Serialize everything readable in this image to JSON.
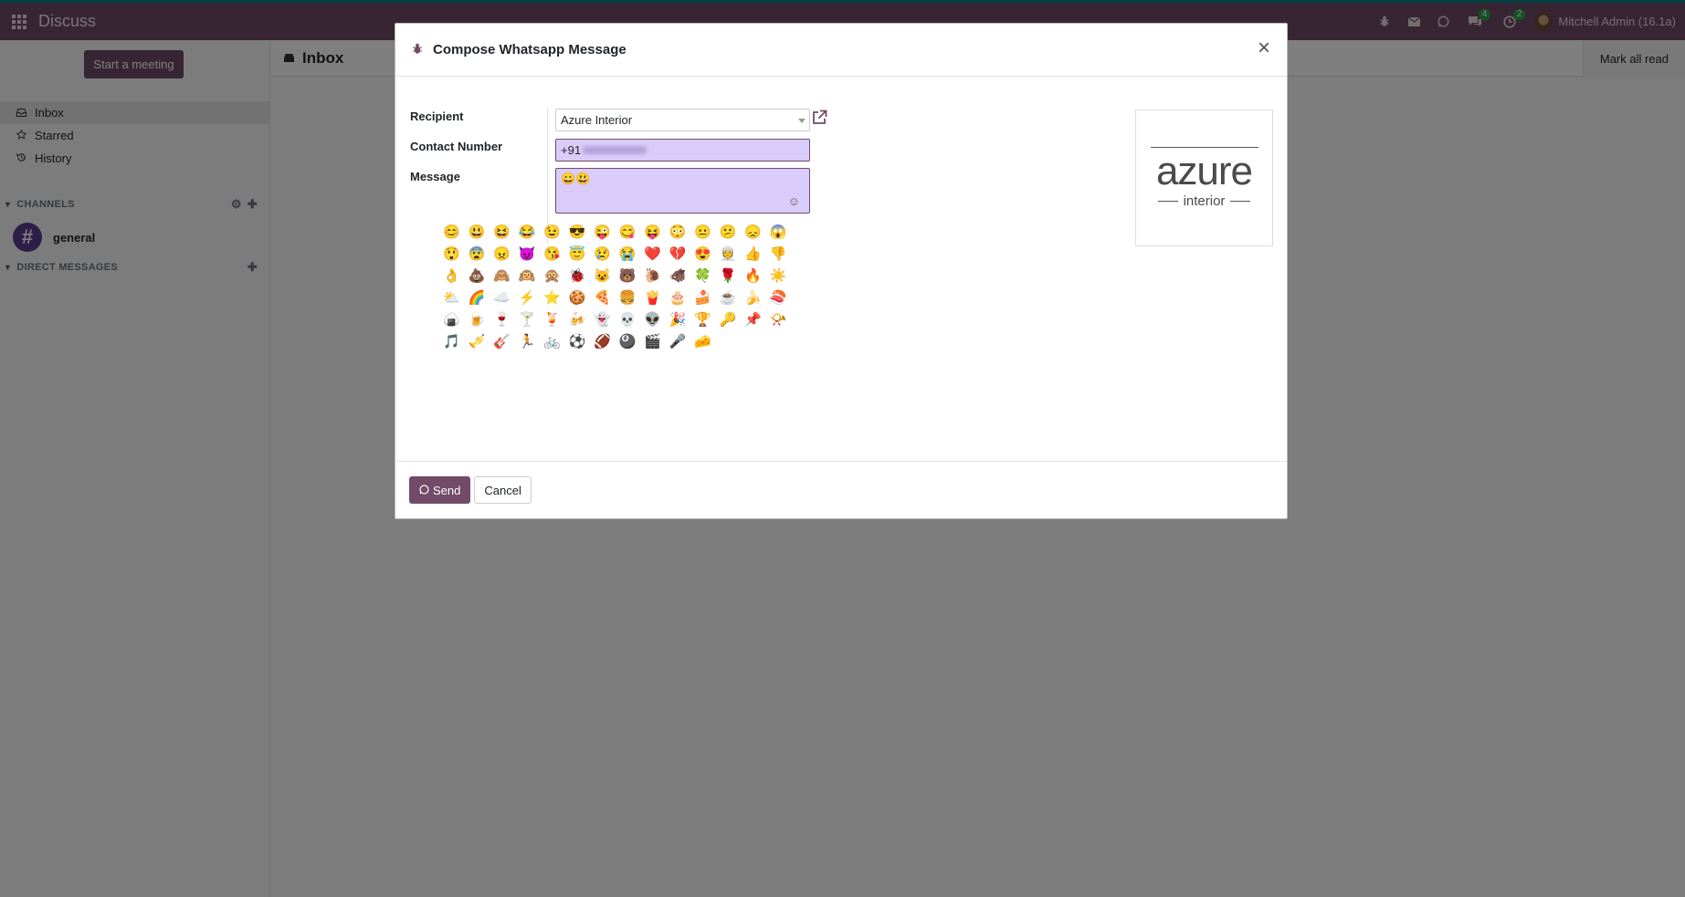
{
  "navbar": {
    "app_name": "Discuss",
    "user_name": "Mitchell Admin (16.1a)",
    "messages_badge": "4",
    "activities_badge": "2"
  },
  "sidebar": {
    "start_meeting_label": "Start a meeting",
    "mailboxes": [
      {
        "label": "Inbox",
        "icon": "inbox-icon",
        "active": true
      },
      {
        "label": "Starred",
        "icon": "star-icon",
        "active": false
      },
      {
        "label": "History",
        "icon": "history-icon",
        "active": false
      }
    ],
    "channels_label": "CHANNELS",
    "direct_messages_label": "DIRECT MESSAGES",
    "channel": {
      "name": "general",
      "symbol": "#"
    }
  },
  "main": {
    "title": "Inbox",
    "mark_all_read_label": "Mark all read"
  },
  "dialog": {
    "title": "Compose Whatsapp Message",
    "close_symbol": "×",
    "fields": {
      "recipient_label": "Recipient",
      "recipient_value": "Azure Interior",
      "contact_label": "Contact Number",
      "contact_prefix": "+91",
      "message_label": "Message",
      "message_value": "😀😃"
    },
    "emojis": [
      "😊",
      "😃",
      "😆",
      "😂",
      "😉",
      "😎",
      "😜",
      "😋",
      "😝",
      "😳",
      "😐",
      "😕",
      "😞",
      "😱",
      "😲",
      "😨",
      "😠",
      "😈",
      "😘",
      "😇",
      "😢",
      "😭",
      "❤️",
      "💔",
      "😍",
      "👳",
      "👍",
      "👎",
      "👌",
      "💩",
      "🙈",
      "🙉",
      "🙊",
      "🐞",
      "😺",
      "🐻",
      "🐌",
      "🐗",
      "🍀",
      "🌹",
      "🔥",
      "☀️",
      "⛅",
      "🌈",
      "☁️",
      "⚡",
      "⭐",
      "🍪",
      "🍕",
      "🍔",
      "🍟",
      "🎂",
      "🍰",
      "☕",
      "🍌",
      "🍣",
      "🍙",
      "🍺",
      "🍷",
      "🍸",
      "🍹",
      "🍻",
      "👻",
      "💀",
      "👽",
      "🎉",
      "🏆",
      "🔑",
      "📌",
      "📯",
      "🎵",
      "🎺",
      "🎸",
      "🏃",
      "🚲",
      "⚽",
      "🏈",
      "🎱",
      "🎬",
      "🎤",
      "🧀"
    ],
    "logo": {
      "big": "azure",
      "small": "interior"
    },
    "send_label": "Send",
    "cancel_label": "Cancel"
  }
}
